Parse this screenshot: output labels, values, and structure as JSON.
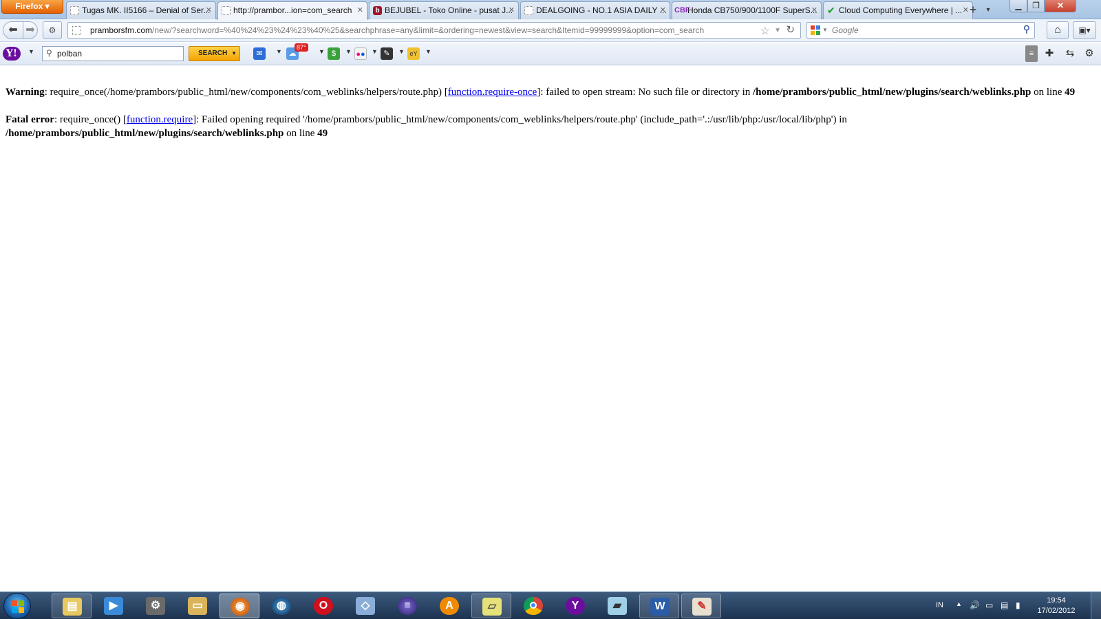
{
  "browser": {
    "menu_button": "Firefox ▾",
    "tabs": [
      {
        "label": "Tugas MK. II5166 – Denial of Ser...",
        "favicon": "blank-page-icon"
      },
      {
        "label": "http://prambor...ion=com_search",
        "favicon": "blank-page-icon"
      },
      {
        "label": "BEJUBEL - Toko Online - pusat J...",
        "favicon": "bejubel-icon"
      },
      {
        "label": "DEALGOING - NO.1 ASIA DAILY ...",
        "favicon": "blank-page-icon"
      },
      {
        "label": "Honda CB750/900/1100F SuperS...",
        "favicon": "cbf-icon"
      },
      {
        "label": "Cloud Computing Everywhere | ...",
        "favicon": "check-icon"
      }
    ],
    "url_host": "pramborsfm.com",
    "url_rest": "/new/?searchword=%40%24%23%24%23%40%25&searchphrase=any&limit=&ordering=newest&view=search&Itemid=99999999&option=com_search",
    "search_placeholder": "Google"
  },
  "yahoo_toolbar": {
    "search_value": "polban",
    "search_button": "SEARCH",
    "weather_badge": "87°"
  },
  "page": {
    "warning": {
      "label": "Warning",
      "text1": ": require_once(/home/prambors/public_html/new/components/com_weblinks/helpers/route.php) [",
      "link": "function.require-once",
      "text2": "]: failed to open stream: No such file or directory in ",
      "path": "/home/prambors/public_html/new/plugins/search/weblinks.php",
      "text3": " on line ",
      "line": "49"
    },
    "fatal": {
      "label": "Fatal error",
      "text1": ": require_once() [",
      "link": "function.require",
      "text2": "]: Failed opening required '/home/prambors/public_html/new/components/com_weblinks/helpers/route.php' (include_path='.:/usr/lib/php:/usr/local/lib/php') in ",
      "path": "/home/prambors/public_html/new/plugins/search/weblinks.php",
      "text3": " on line ",
      "line": "49"
    }
  },
  "taskbar": {
    "language": "IN",
    "time": "19:54",
    "date": "17/02/2012",
    "apps": [
      "file-explorer-icon",
      "media-player-icon",
      "system-icon",
      "folder-icon",
      "firefox-icon",
      "globe-icon",
      "opera-icon",
      "virtualbox-icon",
      "eclipse-icon",
      "avast-icon",
      "notes-icon",
      "chrome-icon",
      "yahoo-messenger-icon",
      "note-app-icon",
      "word-icon",
      "paint-icon"
    ]
  }
}
